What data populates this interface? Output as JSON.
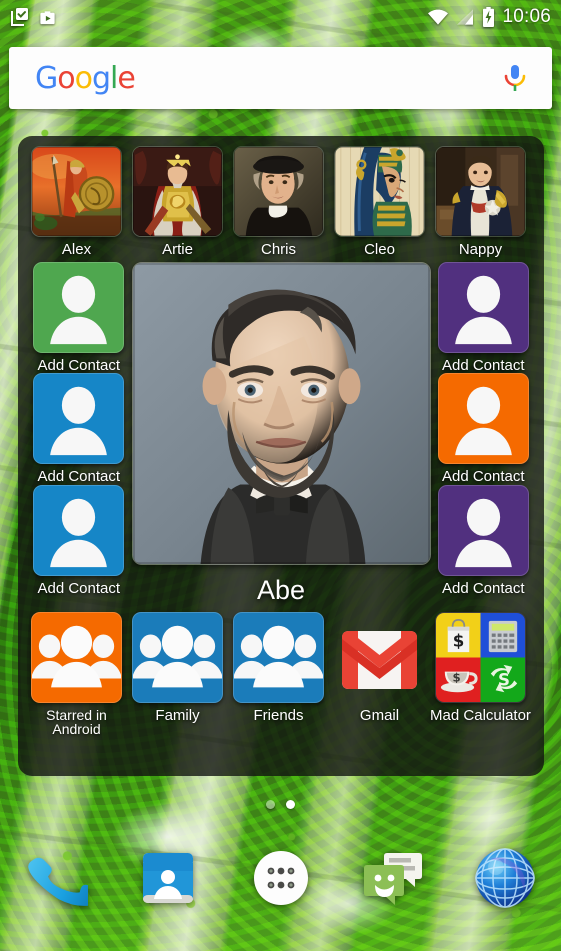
{
  "statusbar": {
    "time": "10:06",
    "icons_left": [
      "task-checkbox-icon",
      "work-playstore-icon"
    ],
    "icons_right": [
      "wifi-icon",
      "cell-signal-icon",
      "battery-charging-icon"
    ]
  },
  "search": {
    "logo_letters": [
      "G",
      "o",
      "o",
      "g",
      "l",
      "e"
    ],
    "placeholder": "",
    "value": "",
    "mic_icon": "microphone-icon"
  },
  "contacts_widget": {
    "top_row": [
      {
        "label": "Alex",
        "icon": "contact-photo-alexander"
      },
      {
        "label": "Artie",
        "icon": "contact-photo-arthur"
      },
      {
        "label": "Chris",
        "icon": "contact-photo-columbus"
      },
      {
        "label": "Cleo",
        "icon": "contact-photo-cleopatra"
      },
      {
        "label": "Nappy",
        "icon": "contact-photo-napoleon"
      }
    ],
    "left_column": [
      {
        "label": "Add Contact",
        "color": "#4fa74f",
        "icon": "person-placeholder-icon"
      },
      {
        "label": "Add Contact",
        "color": "#1686c7",
        "icon": "person-placeholder-icon"
      },
      {
        "label": "Add Contact",
        "color": "#1686c7",
        "icon": "person-placeholder-icon"
      }
    ],
    "right_column": [
      {
        "label": "Add Contact",
        "color": "#51307f",
        "icon": "person-placeholder-icon"
      },
      {
        "label": "Add Contact",
        "color": "#f56a00",
        "icon": "person-placeholder-icon"
      },
      {
        "label": "Add Contact",
        "color": "#51307f",
        "icon": "person-placeholder-icon"
      }
    ],
    "featured": {
      "label": "Abe",
      "icon": "contact-photo-lincoln"
    },
    "bottom_row": [
      {
        "label": "Starred in Android",
        "color": "#f56a00",
        "icon": "contact-group-icon"
      },
      {
        "label": "Family",
        "color": "#1b7cba",
        "icon": "contact-group-icon"
      },
      {
        "label": "Friends",
        "color": "#1b7cba",
        "icon": "contact-group-icon"
      },
      {
        "label": "Gmail",
        "color": "#ffffff",
        "icon": "gmail-icon"
      },
      {
        "label": "Mad Calculator",
        "color": "#000000",
        "icon": "mad-calculator-icon"
      }
    ]
  },
  "pager": {
    "count": 2,
    "active_index": 1
  },
  "dock": {
    "items": [
      {
        "name": "phone",
        "icon": "phone-handset-icon"
      },
      {
        "name": "contacts",
        "icon": "contacts-card-icon"
      },
      {
        "name": "app-drawer",
        "icon": "app-drawer-dots-icon"
      },
      {
        "name": "messaging",
        "icon": "messaging-smiley-icon"
      },
      {
        "name": "browser",
        "icon": "globe-browser-icon"
      }
    ]
  },
  "colors": {
    "panel_bg": "rgba(18,20,16,0.80)",
    "accent_green": "#4fa74f",
    "accent_blue": "#1686c7",
    "accent_purple": "#51307f",
    "accent_orange": "#f56a00",
    "gmail_red": "#ea4335"
  }
}
